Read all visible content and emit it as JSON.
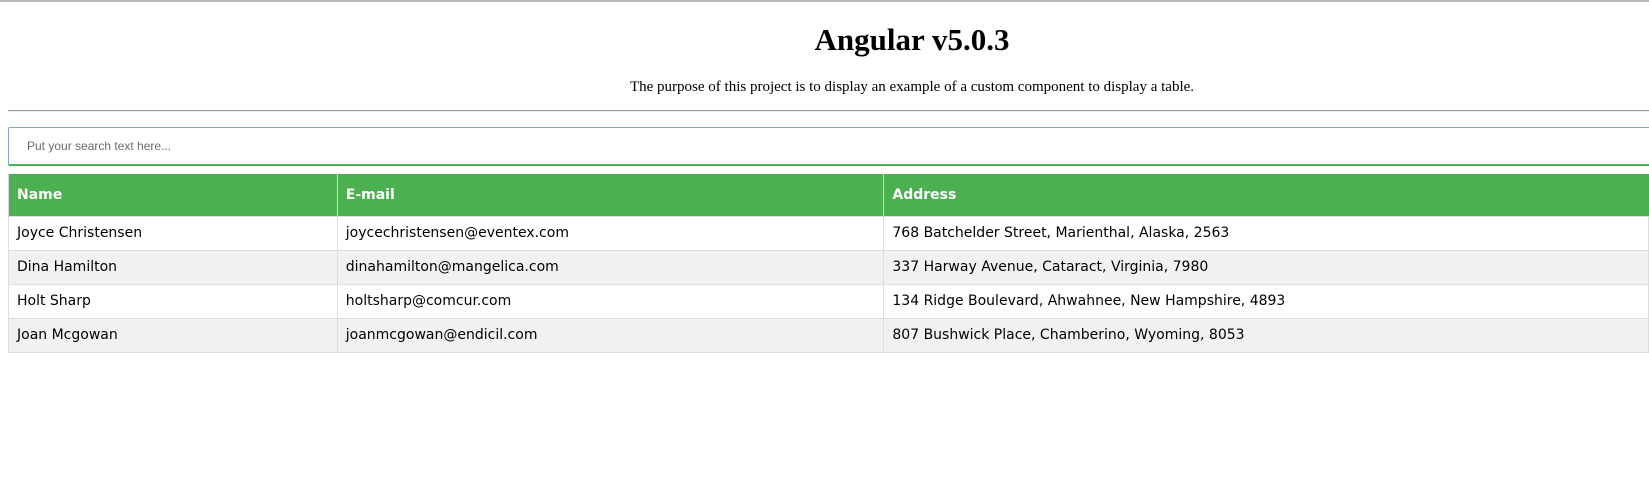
{
  "header": {
    "title": "Angular v5.0.3",
    "description": "The purpose of this project is to display an example of a custom component to display a table."
  },
  "search": {
    "placeholder": "Put your search text here...",
    "value": ""
  },
  "table": {
    "columns": [
      "Name",
      "E-mail",
      "Address"
    ],
    "rows": [
      [
        "Joyce Christensen",
        "joycechristensen@eventex.com",
        "768 Batchelder Street, Marienthal, Alaska, 2563"
      ],
      [
        "Dina Hamilton",
        "dinahamilton@mangelica.com",
        "337 Harway Avenue, Cataract, Virginia, 7980"
      ],
      [
        "Holt Sharp",
        "holtsharp@comcur.com",
        "134 Ridge Boulevard, Ahwahnee, New Hampshire, 4893"
      ],
      [
        "Joan Mcgowan",
        "joanmcgowan@endicil.com",
        "807 Bushwick Place, Chamberino, Wyoming, 8053"
      ]
    ]
  },
  "colors": {
    "header_bg": "#4caf50",
    "header_text": "#ffffff",
    "row_alt_bg": "#f1f1f1",
    "search_focus_border": "#7aa7e6"
  }
}
